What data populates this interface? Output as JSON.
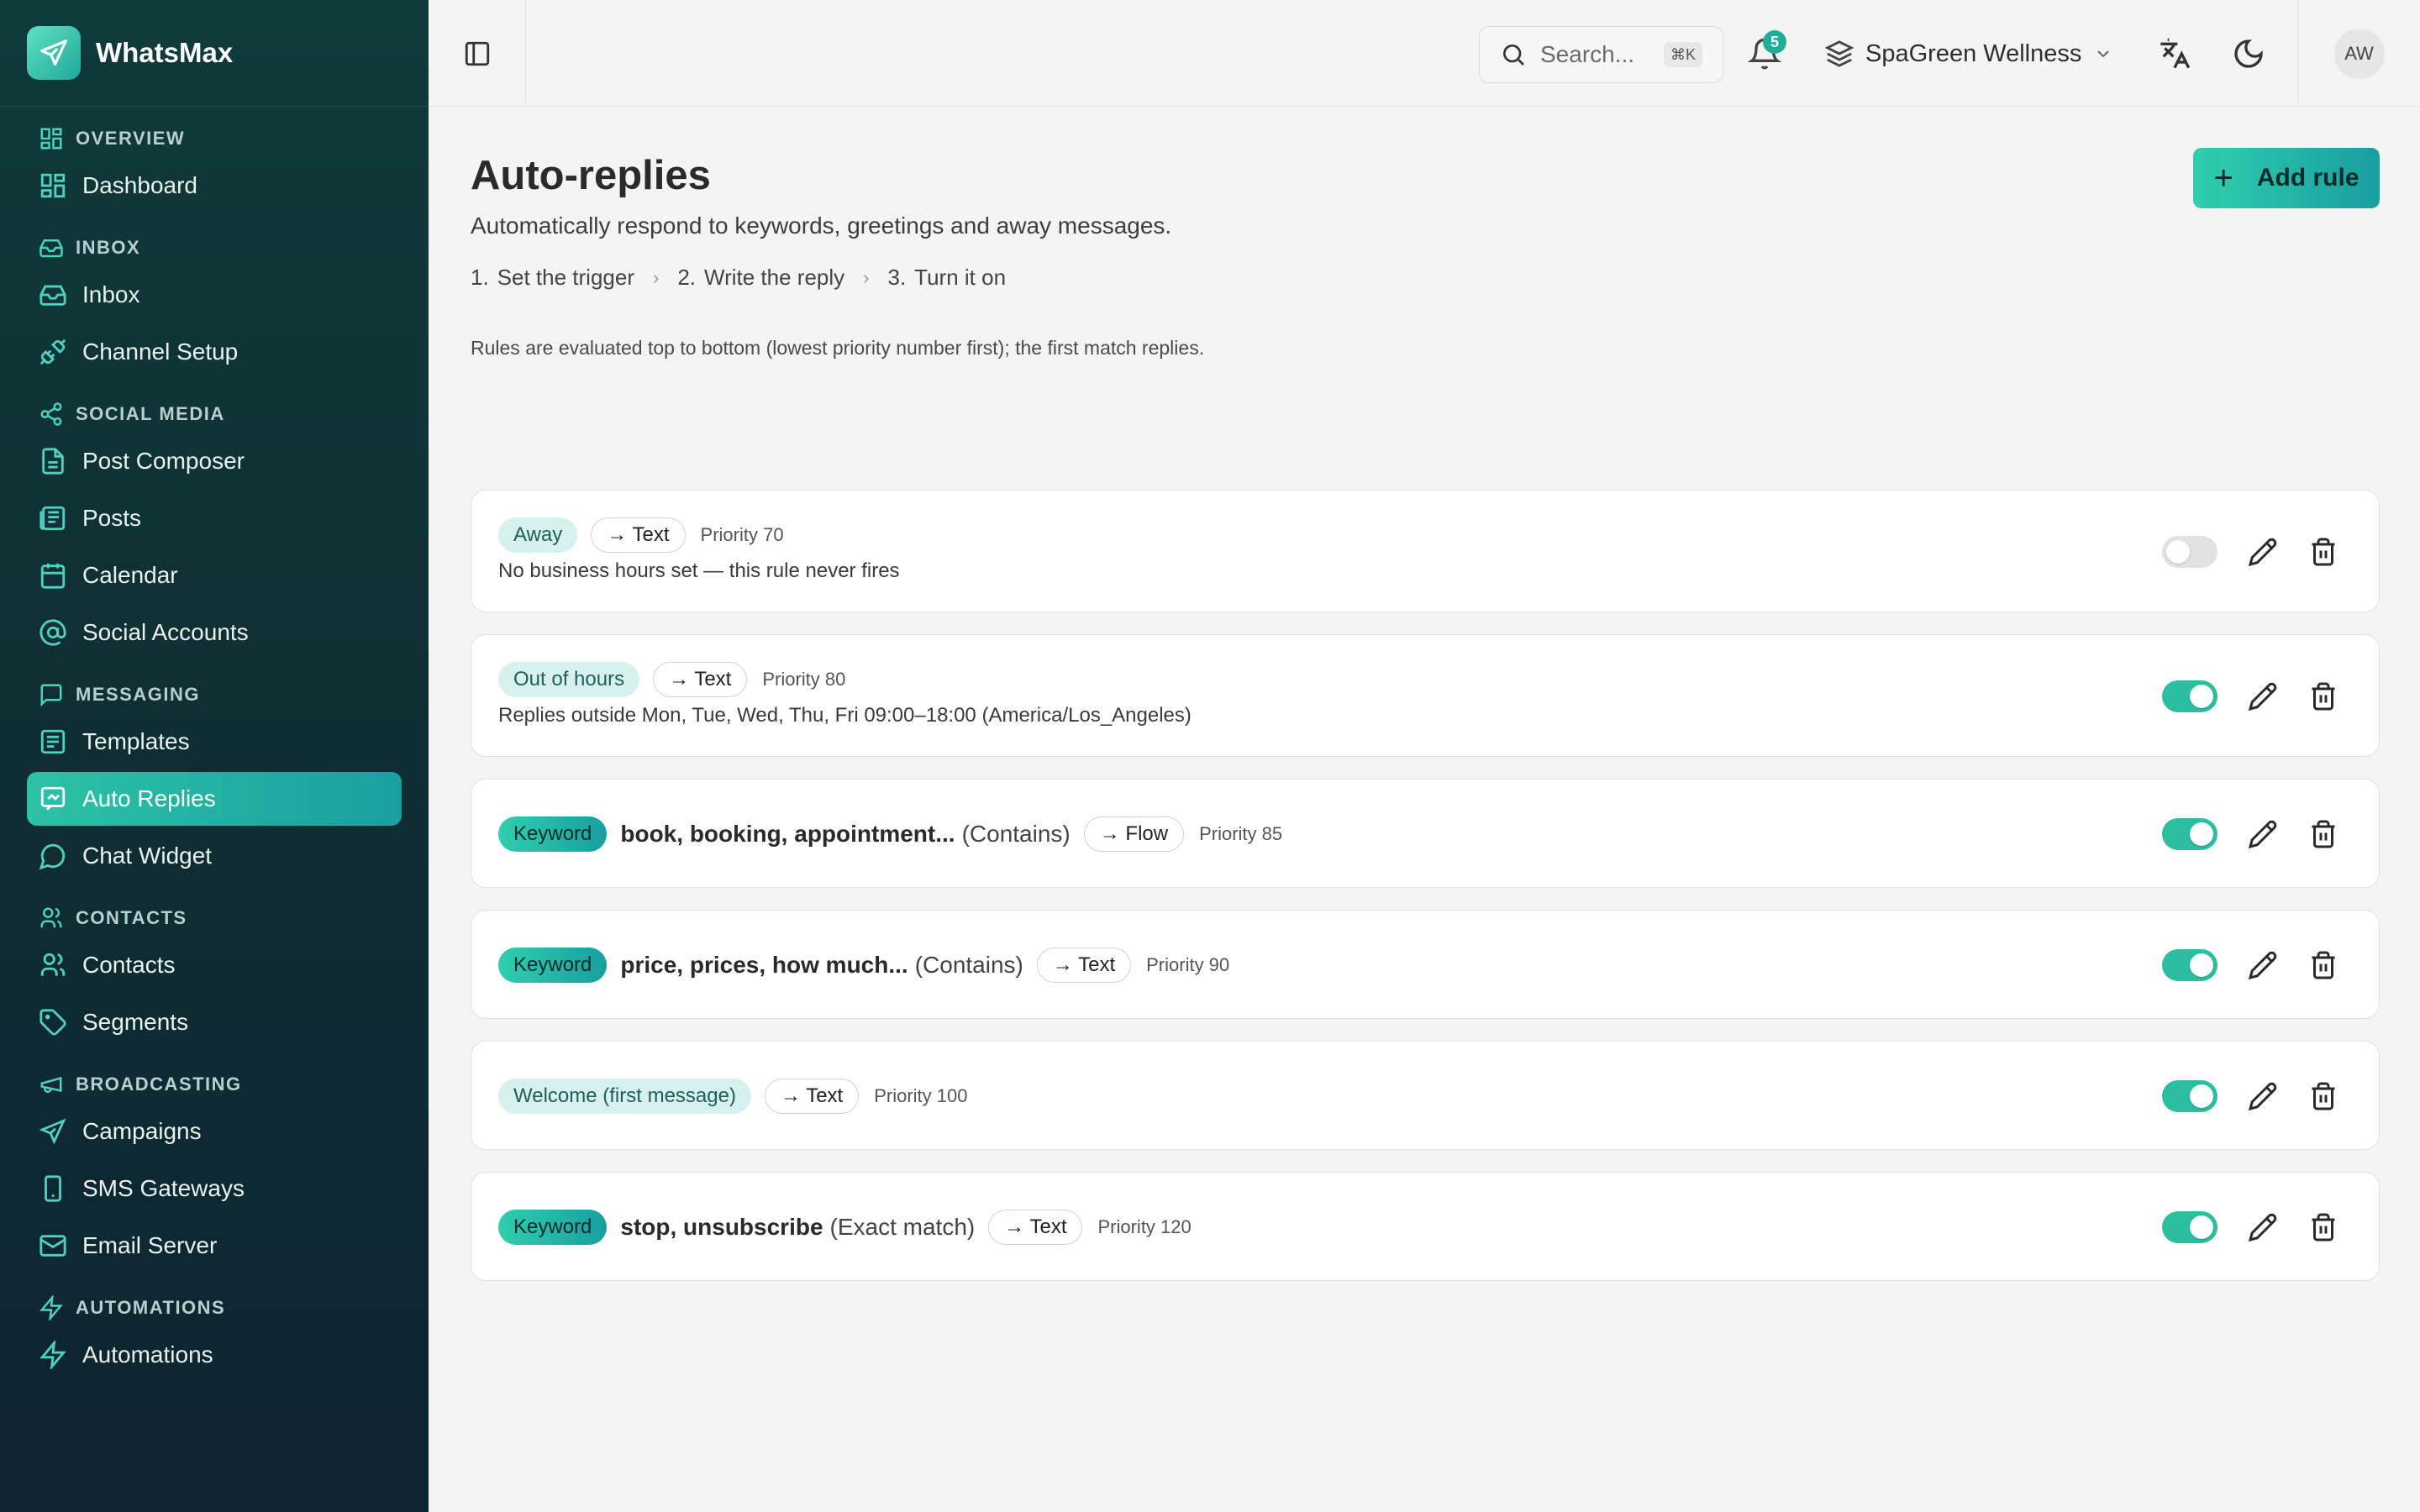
{
  "app": {
    "name": "WhatsMax"
  },
  "sidebar": {
    "sections": [
      {
        "title": "OVERVIEW",
        "icon": "grid-icon",
        "items": [
          {
            "label": "Dashboard",
            "icon": "grid-icon"
          }
        ]
      },
      {
        "title": "INBOX",
        "icon": "inbox-icon",
        "items": [
          {
            "label": "Inbox",
            "icon": "inbox-icon"
          },
          {
            "label": "Channel Setup",
            "icon": "plug-icon"
          }
        ]
      },
      {
        "title": "SOCIAL MEDIA",
        "icon": "share-icon",
        "items": [
          {
            "label": "Post Composer",
            "icon": "file-icon"
          },
          {
            "label": "Posts",
            "icon": "newspaper-icon"
          },
          {
            "label": "Calendar",
            "icon": "calendar-icon"
          },
          {
            "label": "Social Accounts",
            "icon": "at-icon"
          }
        ]
      },
      {
        "title": "MESSAGING",
        "icon": "message-icon",
        "items": [
          {
            "label": "Templates",
            "icon": "template-icon"
          },
          {
            "label": "Auto Replies",
            "icon": "auto-reply-icon",
            "active": true
          },
          {
            "label": "Chat Widget",
            "icon": "chat-bubble-icon"
          }
        ]
      },
      {
        "title": "CONTACTS",
        "icon": "users-icon",
        "items": [
          {
            "label": "Contacts",
            "icon": "users-icon"
          },
          {
            "label": "Segments",
            "icon": "tag-icon"
          }
        ]
      },
      {
        "title": "BROADCASTING",
        "icon": "megaphone-icon",
        "items": [
          {
            "label": "Campaigns",
            "icon": "send-icon"
          },
          {
            "label": "SMS Gateways",
            "icon": "phone-icon"
          },
          {
            "label": "Email Server",
            "icon": "mail-icon"
          }
        ]
      },
      {
        "title": "AUTOMATIONS",
        "icon": "bolt-icon",
        "items": [
          {
            "label": "Automations",
            "icon": "bolt-icon"
          }
        ]
      }
    ]
  },
  "header": {
    "search_placeholder": "Search...",
    "search_shortcut": "⌘K",
    "notifications_count": "5",
    "workspace": "SpaGreen Wellness",
    "avatar_initials": "AW"
  },
  "page": {
    "title": "Auto-replies",
    "subtitle": "Automatically respond to keywords, greetings and away messages.",
    "add_button": "Add rule",
    "steps": [
      {
        "num": "1.",
        "label": "Set the trigger"
      },
      {
        "num": "2.",
        "label": "Write the reply"
      },
      {
        "num": "3.",
        "label": "Turn it on"
      }
    ],
    "note": "Rules are evaluated top to bottom (lowest priority number first); the first match replies."
  },
  "rules": [
    {
      "type": "Away",
      "style": "soft",
      "action": "→ Text",
      "priority": "Priority 70",
      "description": "No business hours set — this rule never fires",
      "enabled": false
    },
    {
      "type": "Out of hours",
      "style": "soft",
      "action": "→ Text",
      "priority": "Priority 80",
      "description": "Replies outside Mon, Tue, Wed, Thu, Fri 09:00–18:00 (America/Los_Angeles)",
      "enabled": true
    },
    {
      "type": "Keyword",
      "style": "strong",
      "keywords": "book, booking, appointment...",
      "mode": "(Contains)",
      "action": "→ Flow",
      "priority": "Priority 85",
      "enabled": true
    },
    {
      "type": "Keyword",
      "style": "strong",
      "keywords": "price, prices, how much...",
      "mode": "(Contains)",
      "action": "→ Text",
      "priority": "Priority 90",
      "enabled": true
    },
    {
      "type": "Welcome (first message)",
      "style": "soft",
      "action": "→ Text",
      "priority": "Priority 100",
      "enabled": true
    },
    {
      "type": "Keyword",
      "style": "strong",
      "keywords": "stop, unsubscribe",
      "mode": "(Exact match)",
      "action": "→ Text",
      "priority": "Priority 120",
      "enabled": true
    }
  ],
  "colors": {
    "accent": "#2bbf9f",
    "sidebar_bg": "#0f3a3a",
    "accent_dark": "#199ea0"
  }
}
